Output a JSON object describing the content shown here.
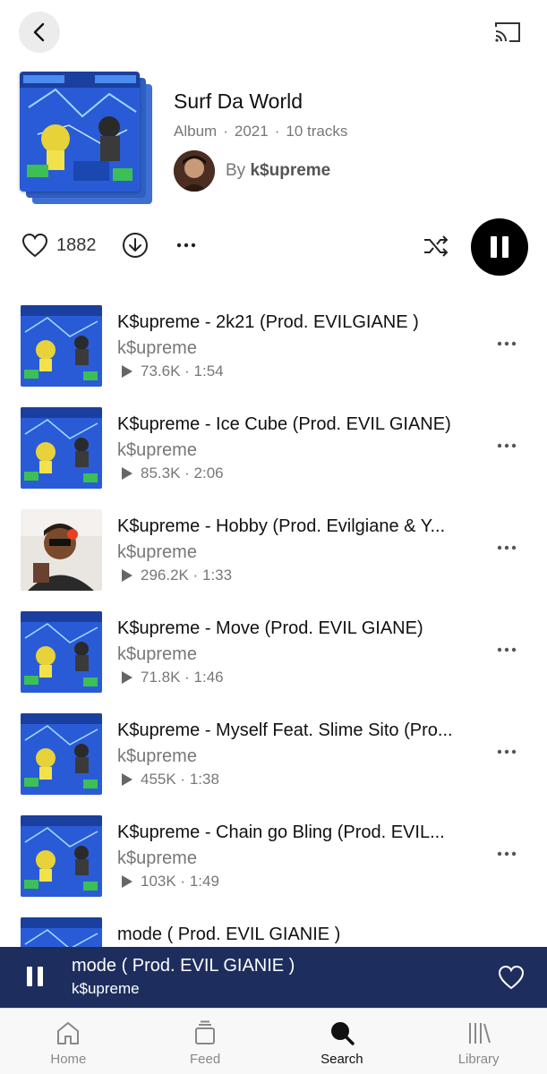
{
  "album": {
    "title": "Surf Da World",
    "type": "Album",
    "year": "2021",
    "track_count": "10 tracks",
    "by_label": "By",
    "artist": "k$upreme"
  },
  "actions": {
    "like_count": "1882"
  },
  "tracks": [
    {
      "title": "K$upreme - 2k21 (Prod. EVILGIANE )",
      "artist": "k$upreme",
      "plays": "73.6K",
      "duration": "1:54",
      "art": "cover"
    },
    {
      "title": "K$upreme - Ice Cube (Prod. EVIL GIANE)",
      "artist": "k$upreme",
      "plays": "85.3K",
      "duration": "2:06",
      "art": "cover"
    },
    {
      "title": "K$upreme - Hobby (Prod. Evilgiane & Y...",
      "artist": "k$upreme",
      "plays": "296.2K",
      "duration": "1:33",
      "art": "photo"
    },
    {
      "title": "K$upreme - Move (Prod. EVIL GIANE)",
      "artist": "k$upreme",
      "plays": "71.8K",
      "duration": "1:46",
      "art": "cover"
    },
    {
      "title": "K$upreme - Myself Feat. Slime Sito (Pro...",
      "artist": "k$upreme",
      "plays": "455K",
      "duration": "1:38",
      "art": "cover"
    },
    {
      "title": "K$upreme - Chain go Bling (Prod. EVIL...",
      "artist": "k$upreme",
      "plays": "103K",
      "duration": "1:49",
      "art": "cover"
    },
    {
      "title": "mode ( Prod. EVIL GIANIE )",
      "artist": "",
      "plays": "",
      "duration": "",
      "art": "cover"
    }
  ],
  "now_playing": {
    "title": "mode ( Prod. EVIL GIANIE )",
    "artist": "k$upreme"
  },
  "tabs": [
    {
      "label": "Home",
      "icon": "home-icon",
      "active": false
    },
    {
      "label": "Feed",
      "icon": "feed-icon",
      "active": false
    },
    {
      "label": "Search",
      "icon": "search-icon",
      "active": true
    },
    {
      "label": "Library",
      "icon": "library-icon",
      "active": false
    }
  ],
  "colors": {
    "mini_player_bg": "#1d2e5e",
    "cover_blue": "#2a5bd7",
    "accent_black": "#000000"
  }
}
